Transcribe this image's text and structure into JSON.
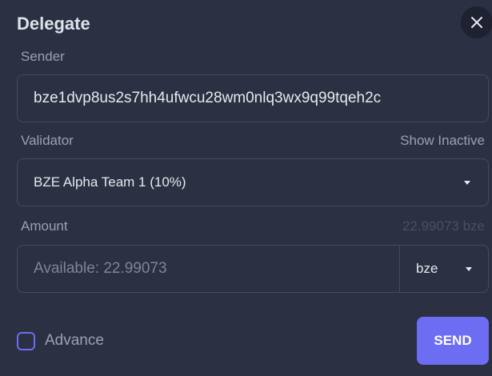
{
  "dialog": {
    "title": "Delegate",
    "close_icon": "close-icon"
  },
  "sender": {
    "label": "Sender",
    "value": "bze1dvp8us2s7hh4ufwcu28wm0nlq3wx9q99tqeh2c"
  },
  "validator": {
    "label": "Validator",
    "show_inactive_label": "Show Inactive",
    "selected": "BZE Alpha Team 1 (10%)"
  },
  "amount": {
    "label": "Amount",
    "balance_text": "22.99073 bze",
    "placeholder": "Available: 22.99073",
    "denom": "bze"
  },
  "advance": {
    "label": "Advance",
    "checked": false
  },
  "send_button": {
    "label": "SEND"
  },
  "colors": {
    "background": "#2b3042",
    "accent": "#6c6df2",
    "border": "#464c60"
  }
}
